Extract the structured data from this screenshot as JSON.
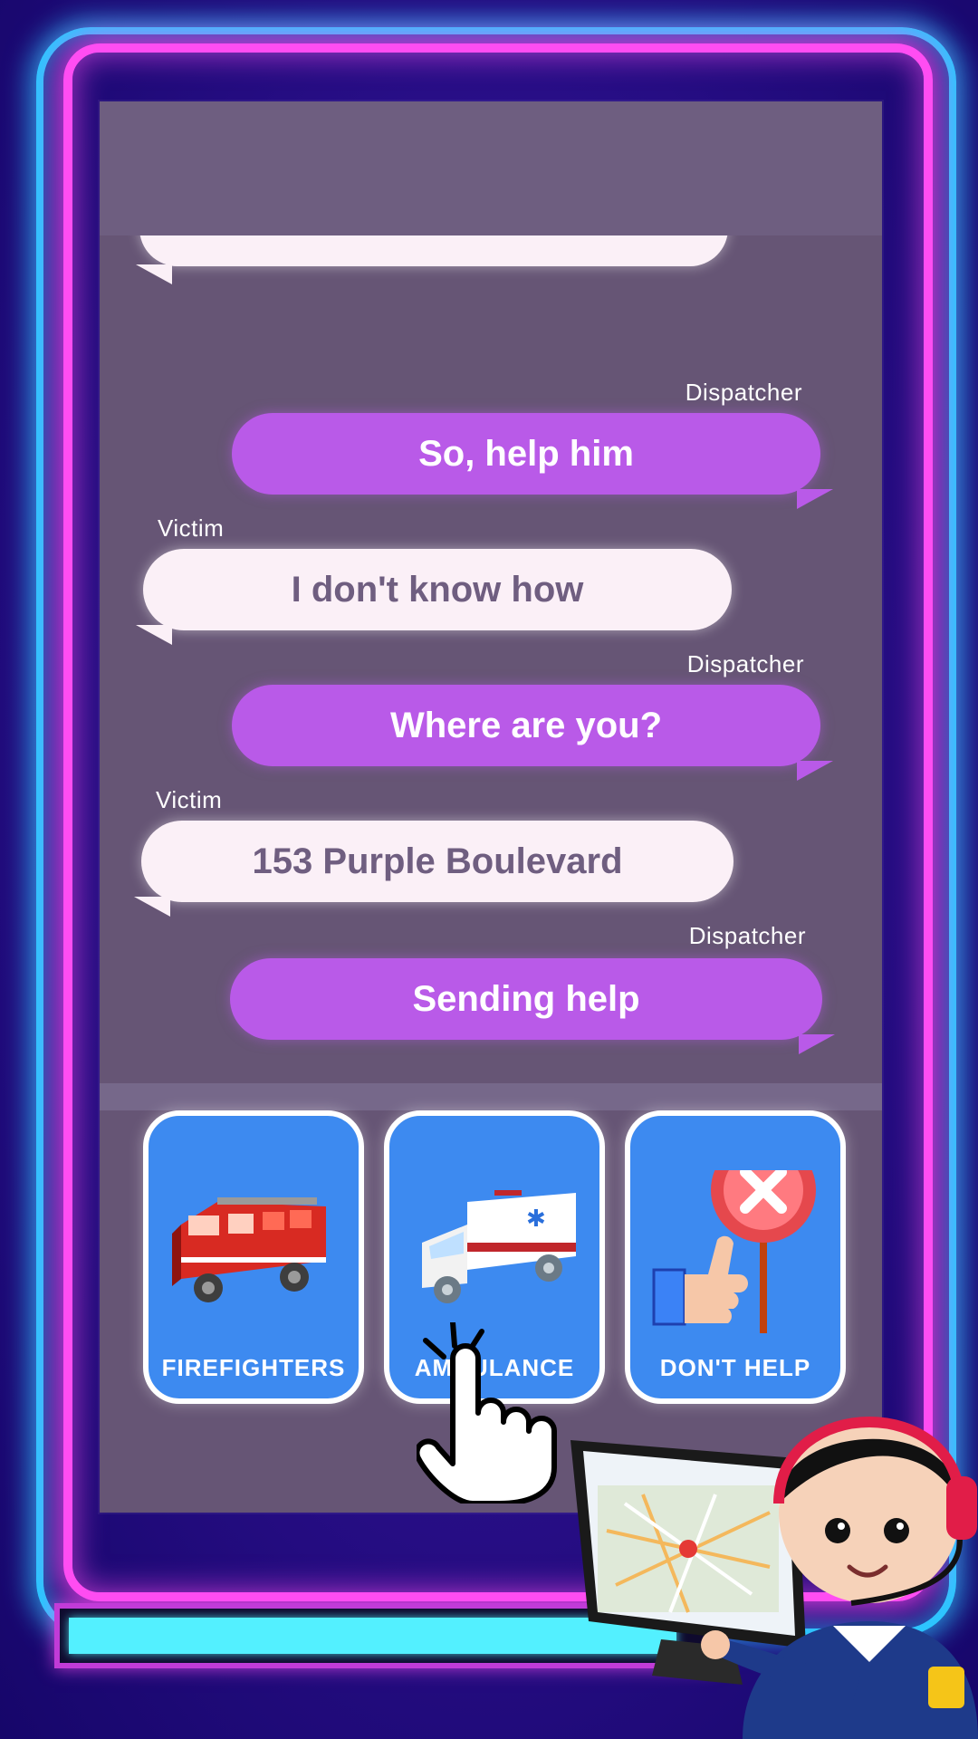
{
  "chat": {
    "messages": [
      {
        "sender": "Dispatcher",
        "text": "So, help him"
      },
      {
        "sender": "Victim",
        "text": "I don't know how"
      },
      {
        "sender": "Dispatcher",
        "text": "Where are you?"
      },
      {
        "sender": "Victim",
        "text": "153 Purple Boulevard"
      },
      {
        "sender": "Dispatcher",
        "text": "Sending help"
      }
    ]
  },
  "choices": [
    {
      "label": "FIREFIGHTERS",
      "icon": "fire-truck-icon"
    },
    {
      "label": "AMBULANCE",
      "icon": "ambulance-icon"
    },
    {
      "label": "DON'T HELP",
      "icon": "thumb-reject-sign-icon"
    }
  ],
  "progress": {
    "value": 0.96
  },
  "colors": {
    "phone_bg": "#665575",
    "dispatcher_bubble": "#b95ae8",
    "victim_bubble": "#fbf0f7",
    "choice_bg": "#3d8af0",
    "neon_pink": "#ff4df2",
    "neon_blue": "#29c8ff",
    "progress_fill": "#53f0ff"
  }
}
